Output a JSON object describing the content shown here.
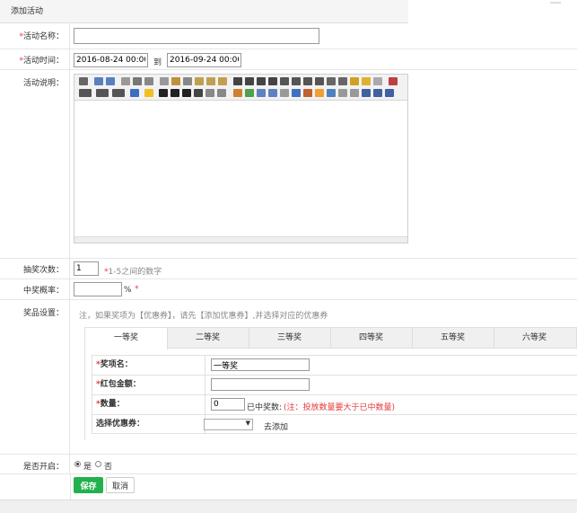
{
  "page": {
    "title": "添加活动"
  },
  "form": {
    "name": {
      "label": "活动名称：",
      "value": "",
      "required": true
    },
    "time": {
      "label": "活动时间：",
      "start": "2016-08-24 00:00:00",
      "sep": "到",
      "end": "2016-09-24 00:00:00",
      "required": true
    },
    "desc": {
      "label": "活动说明："
    },
    "draws": {
      "label": "抽奖次数：",
      "value": "1",
      "hint": "1-5之间的数字",
      "required_mark": "*"
    },
    "rate": {
      "label": "中奖概率：",
      "value": "",
      "unit": "%",
      "required_mark": "*"
    },
    "prizes": {
      "label": "奖品设置：",
      "note": "注，如果奖项为【优惠券】，请先【添加优惠券】,并选择对应的优惠券",
      "tabs": [
        "一等奖",
        "二等奖",
        "三等奖",
        "四等奖",
        "五等奖",
        "六等奖"
      ],
      "active_tab": 0,
      "fields": {
        "prize_name": {
          "label": "奖项名：",
          "value": "一等奖"
        },
        "red_packet": {
          "label": "红包金额：",
          "value": ""
        },
        "quantity": {
          "label": "数量：",
          "value": "0",
          "won_label": "已中奖数:",
          "note": "(注：投放数量要大于已中数量)"
        },
        "coupon": {
          "label": "选择优惠券：",
          "selected": "",
          "add_text": "去添加"
        }
      }
    },
    "enabled": {
      "label": "是否开启：",
      "yes": "是",
      "no": "否",
      "value": "yes"
    }
  },
  "buttons": {
    "save": "保存",
    "cancel": "取消"
  },
  "colors": {
    "primary": "#22b14c",
    "required": "#e4393c"
  }
}
